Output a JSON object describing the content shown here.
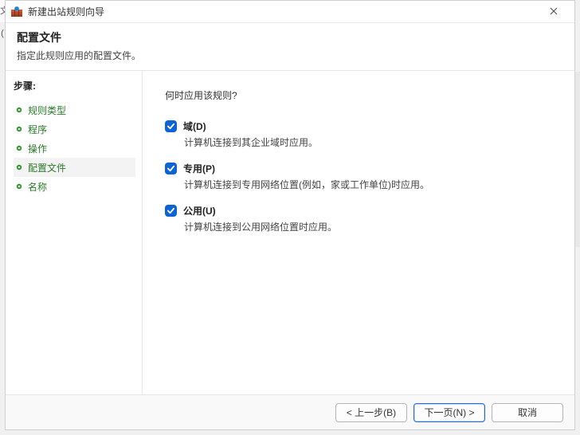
{
  "window": {
    "title": "新建出站规则向导"
  },
  "header": {
    "title": "配置文件",
    "description": "指定此规则应用的配置文件。"
  },
  "sidebar": {
    "steps_label": "步骤:",
    "steps": [
      {
        "label": "规则类型",
        "current": false
      },
      {
        "label": "程序",
        "current": false
      },
      {
        "label": "操作",
        "current": false
      },
      {
        "label": "配置文件",
        "current": true
      },
      {
        "label": "名称",
        "current": false
      }
    ]
  },
  "content": {
    "question": "何时应用该规则?",
    "options": [
      {
        "key": "domain",
        "checked": true,
        "label": "域(D)",
        "description": "计算机连接到其企业域时应用。"
      },
      {
        "key": "private",
        "checked": true,
        "label": "专用(P)",
        "description": "计算机连接到专用网络位置(例如，家或工作单位)时应用。"
      },
      {
        "key": "public",
        "checked": true,
        "label": "公用(U)",
        "description": "计算机连接到公用网络位置时应用。"
      }
    ]
  },
  "footer": {
    "back_label": "< 上一步(B)",
    "next_label": "下一页(N) >",
    "cancel_label": "取消"
  },
  "left_sliver_text": "文("
}
